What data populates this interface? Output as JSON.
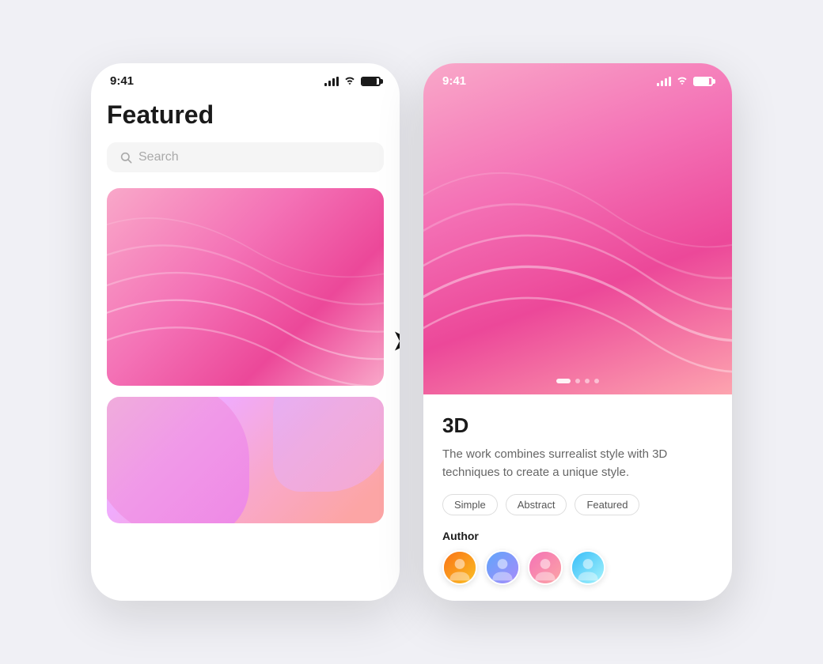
{
  "scene": {
    "background": "#f0f0f5"
  },
  "phone_left": {
    "status": {
      "time": "9:41"
    },
    "title": "Featured",
    "search": {
      "placeholder": "Search"
    }
  },
  "phone_right": {
    "status": {
      "time": "9:41"
    },
    "detail": {
      "title": "3D",
      "description": "The work combines surrealist style with 3D techniques to create a unique style.",
      "tags": [
        "Simple",
        "Abstract",
        "Featured"
      ],
      "author_label": "Author"
    },
    "hero_dots": [
      "active",
      "",
      "",
      ""
    ]
  }
}
